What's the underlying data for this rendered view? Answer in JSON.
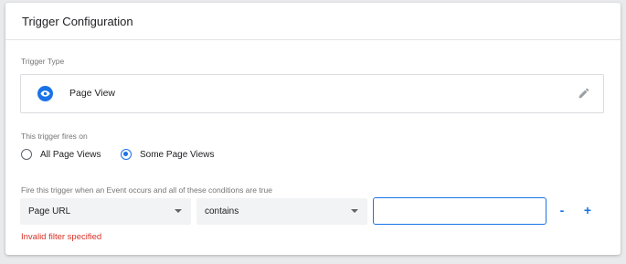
{
  "card": {
    "title": "Trigger Configuration"
  },
  "trigger_type": {
    "label": "Trigger Type",
    "name": "Page View",
    "icon": "eye-icon",
    "accent": "#1a73e8"
  },
  "fires_on": {
    "label": "This trigger fires on",
    "options": [
      {
        "label": "All Page Views",
        "selected": false
      },
      {
        "label": "Some Page Views",
        "selected": true
      }
    ]
  },
  "conditions": {
    "label": "Fire this trigger when an Event occurs and all of these conditions are true",
    "variable": "Page URL",
    "operator": "contains",
    "value": "",
    "remove_label": "-",
    "add_label": "+"
  },
  "error": {
    "text": "Invalid filter specified",
    "color": "#d93025"
  }
}
